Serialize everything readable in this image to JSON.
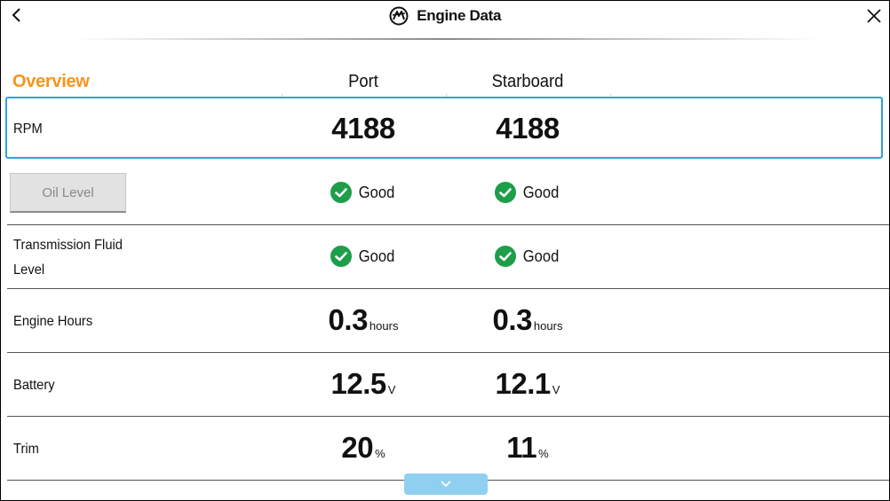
{
  "header": {
    "title": "Engine Data",
    "back_icon": "chevron-left-icon",
    "close_icon": "close-icon",
    "logo_icon": "mercury-logo-icon"
  },
  "table": {
    "overview_label": "Overview",
    "columns": [
      "Port",
      "Starboard"
    ],
    "rows": [
      {
        "label": "RPM",
        "port": "4188",
        "starboard": "4188",
        "unit": ""
      },
      {
        "label": "Oil Level",
        "port": "Good",
        "starboard": "Good",
        "type": "status"
      },
      {
        "label": "Transmission Fluid Level",
        "label_line1": "Transmission Fluid",
        "label_line2": "Level",
        "port": "Good",
        "starboard": "Good",
        "type": "status"
      },
      {
        "label": "Engine Hours",
        "port": "0.3",
        "starboard": "0.3",
        "unit": "hours"
      },
      {
        "label": "Battery",
        "port": "12.5",
        "starboard": "12.1",
        "unit": "V"
      },
      {
        "label": "Trim",
        "port": "20",
        "starboard": "11",
        "unit": "%"
      }
    ]
  },
  "scroll": {
    "icon": "chevron-down-icon"
  },
  "colors": {
    "accent": "#f7941d",
    "selection": "#2fa3d9",
    "good": "#1e9e4a",
    "scroll_button": "#8fd0f0"
  }
}
